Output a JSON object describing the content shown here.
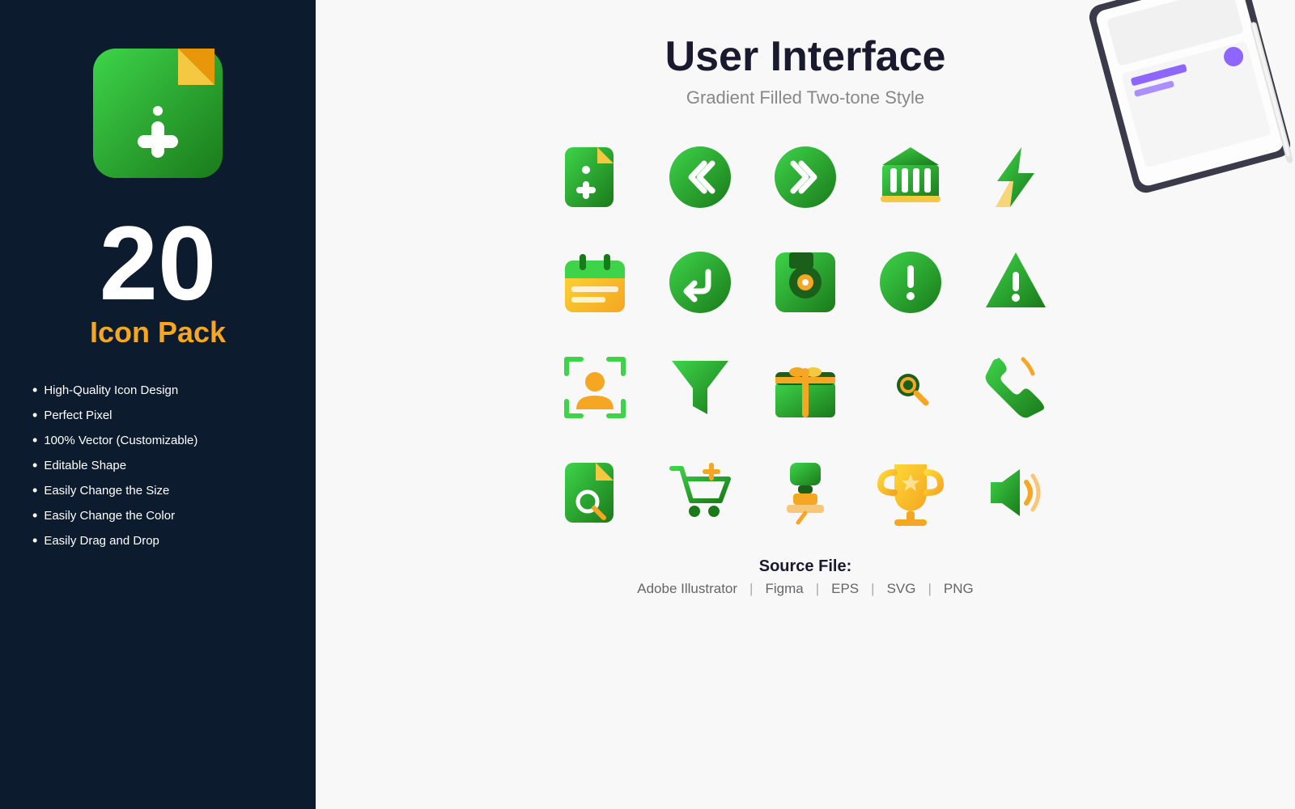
{
  "left": {
    "big_number": "20",
    "pack_label": "Icon Pack",
    "features": [
      "High-Quality Icon Design",
      "Perfect Pixel",
      "100% Vector (Customizable)",
      "Editable Shape",
      "Easily Change the Size",
      "Easily Change the Color",
      "Easily Drag and Drop"
    ]
  },
  "right": {
    "title": "User Interface",
    "subtitle": "Gradient Filled Two-tone Style",
    "source_label": "Source File:",
    "formats": [
      "Adobe Illustrator",
      "Figma",
      "EPS",
      "SVG",
      "PNG"
    ]
  }
}
